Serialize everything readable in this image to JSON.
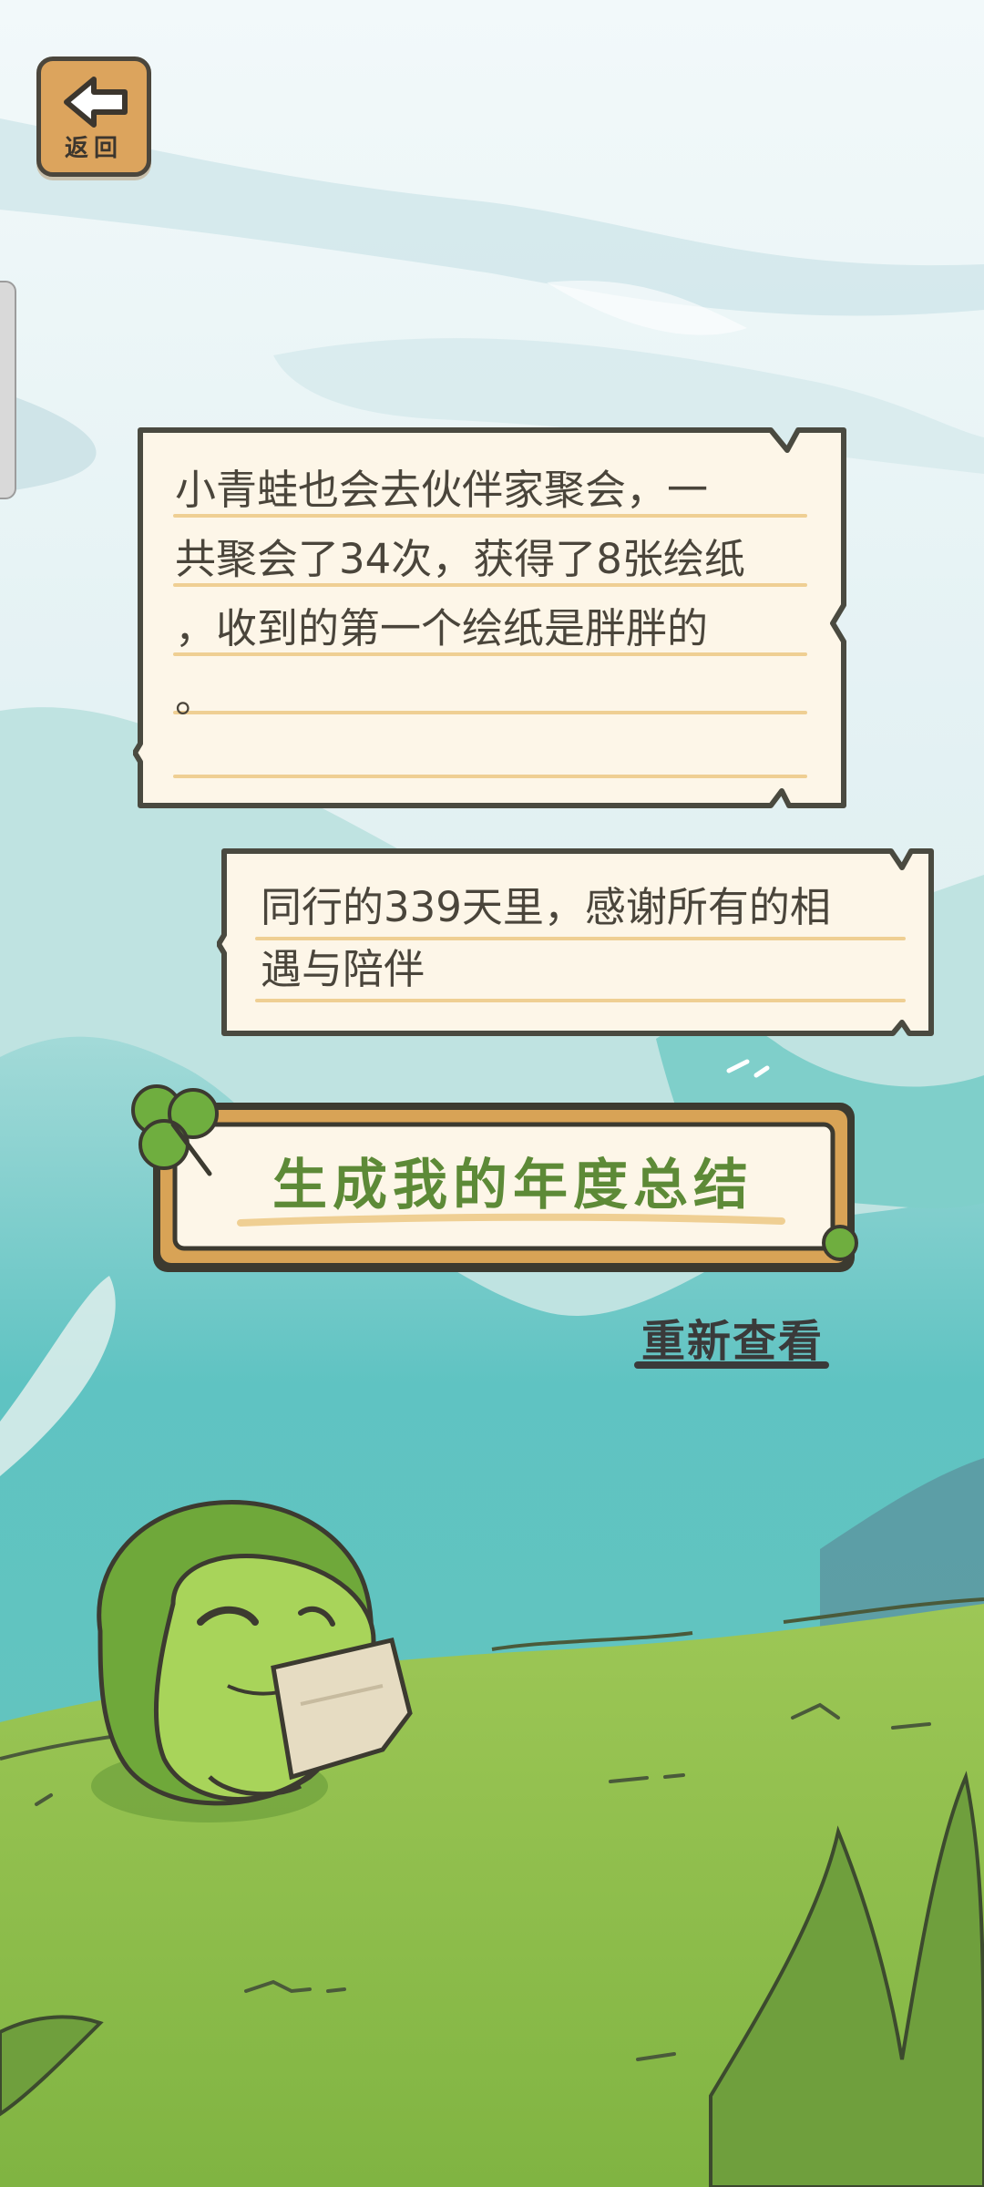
{
  "header": {
    "back_label": "返回"
  },
  "messages": [
    {
      "text": "小青蛙也会去伙伴家聚会，一\n共聚会了34次，获得了8张绘纸\n，收到的第一个绘纸是胖胖的\n。"
    },
    {
      "text": "同行的339天里，感谢所有的相\n遇与陪伴"
    }
  ],
  "actions": {
    "generate_label": "生成我的年度总结",
    "review_label": "重新查看"
  },
  "colors": {
    "grass": "#8fbf4a",
    "sky": "#e9f4f5",
    "mountain": "#5fc0c0",
    "note_bg": "#fdf6e8",
    "accent": "#5d8a37"
  },
  "icons": [
    "back-arrow-icon",
    "clover-icon",
    "frog-character"
  ]
}
